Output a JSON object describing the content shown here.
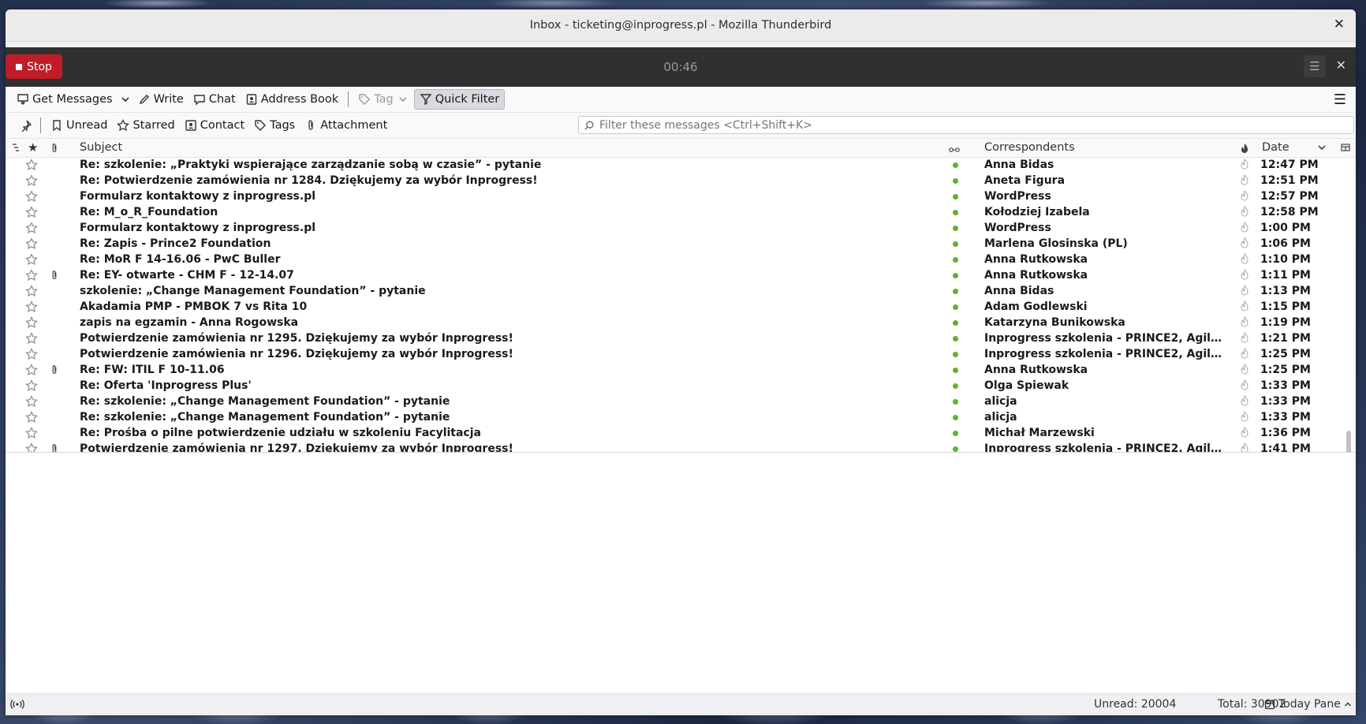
{
  "window": {
    "title": "Inbox - ticketing@inprogress.pl - Mozilla Thunderbird"
  },
  "recorder": {
    "stop_label": "Stop",
    "timer": "00:46"
  },
  "toolbar": {
    "get_messages": "Get Messages",
    "write": "Write",
    "chat": "Chat",
    "address_book": "Address Book",
    "tag": "Tag",
    "quick_filter": "Quick Filter"
  },
  "filterbar": {
    "unread": "Unread",
    "starred": "Starred",
    "contact": "Contact",
    "tags": "Tags",
    "attachment": "Attachment",
    "search_placeholder": "Filter these messages <Ctrl+Shift+K>"
  },
  "columns": {
    "subject": "Subject",
    "correspondents": "Correspondents",
    "date": "Date"
  },
  "messages": [
    {
      "subject": "Re: szkolenie: „Praktyki wspierające zarządzanie sobą w czasie” - pytanie",
      "correspondent": "Anna Bidas",
      "date": "12:47 PM",
      "attachment": false
    },
    {
      "subject": "Re: Potwierdzenie zamówienia nr 1284. Dziękujemy za wybór Inprogress!",
      "correspondent": "Aneta Figura",
      "date": "12:51 PM",
      "attachment": false
    },
    {
      "subject": "Formularz kontaktowy z inprogress.pl",
      "correspondent": "WordPress",
      "date": "12:57 PM",
      "attachment": false
    },
    {
      "subject": "Re: M_o_R_Foundation",
      "correspondent": "Kołodziej Izabela",
      "date": "12:58 PM",
      "attachment": false
    },
    {
      "subject": "Formularz kontaktowy z inprogress.pl",
      "correspondent": "WordPress",
      "date": "1:00 PM",
      "attachment": false
    },
    {
      "subject": "Re: Zapis - Prince2 Foundation",
      "correspondent": "Marlena Glosinska (PL)",
      "date": "1:06 PM",
      "attachment": false
    },
    {
      "subject": "Re: MoR F 14-16.06 - PwC Buller",
      "correspondent": "Anna Rutkowska",
      "date": "1:10 PM",
      "attachment": false
    },
    {
      "subject": "Re: EY- otwarte - CHM F - 12-14.07",
      "correspondent": "Anna Rutkowska",
      "date": "1:11 PM",
      "attachment": true
    },
    {
      "subject": "szkolenie: „Change Management Foundation” - pytanie",
      "correspondent": "Anna Bidas",
      "date": "1:13 PM",
      "attachment": false
    },
    {
      "subject": "Akadamia PMP - PMBOK 7 vs Rita 10",
      "correspondent": "Adam Godlewski",
      "date": "1:15 PM",
      "attachment": false
    },
    {
      "subject": "zapis na egzamin - Anna Rogowska",
      "correspondent": "Katarzyna Bunikowska",
      "date": "1:19 PM",
      "attachment": false
    },
    {
      "subject": "Potwierdzenie zamówienia nr 1295. Dziękujemy za wybór Inprogress!",
      "correspondent": "Inprogress szkolenia - PRINCE2, AgilePM, P...",
      "date": "1:21 PM",
      "attachment": false
    },
    {
      "subject": "Potwierdzenie zamówienia nr 1296. Dziękujemy za wybór Inprogress!",
      "correspondent": "Inprogress szkolenia - PRINCE2, AgilePM, P...",
      "date": "1:25 PM",
      "attachment": false
    },
    {
      "subject": "Re: FW: ITIL F 10-11.06",
      "correspondent": "Anna Rutkowska",
      "date": "1:25 PM",
      "attachment": true
    },
    {
      "subject": "Re: Oferta 'Inprogress Plus'",
      "correspondent": "Olga Śpiewak",
      "date": "1:33 PM",
      "attachment": false
    },
    {
      "subject": "Re: szkolenie: „Change Management Foundation” - pytanie",
      "correspondent": "alicja",
      "date": "1:33 PM",
      "attachment": false
    },
    {
      "subject": "Re: szkolenie: „Change Management Foundation” - pytanie",
      "correspondent": "alicja",
      "date": "1:33 PM",
      "attachment": false
    },
    {
      "subject": "Re: Prośba o pilne potwierdzenie udziału w szkoleniu Facylitacja",
      "correspondent": "Michał Marzewski",
      "date": "1:36 PM",
      "attachment": false
    },
    {
      "subject": "Potwierdzenie zamówienia nr 1297. Dziękujemy za wybór Inprogress!",
      "correspondent": "Inprogress szkolenia - PRINCE2, AgilePM, P...",
      "date": "1:41 PM",
      "attachment": true
    }
  ],
  "status": {
    "unread": "Unread: 20004",
    "total": "Total: 30902",
    "today_pane": "Today Pane"
  },
  "colors": {
    "unread_dot": "#5bb434",
    "stop_button": "#c01c28",
    "recorder_bar": "#303030"
  }
}
